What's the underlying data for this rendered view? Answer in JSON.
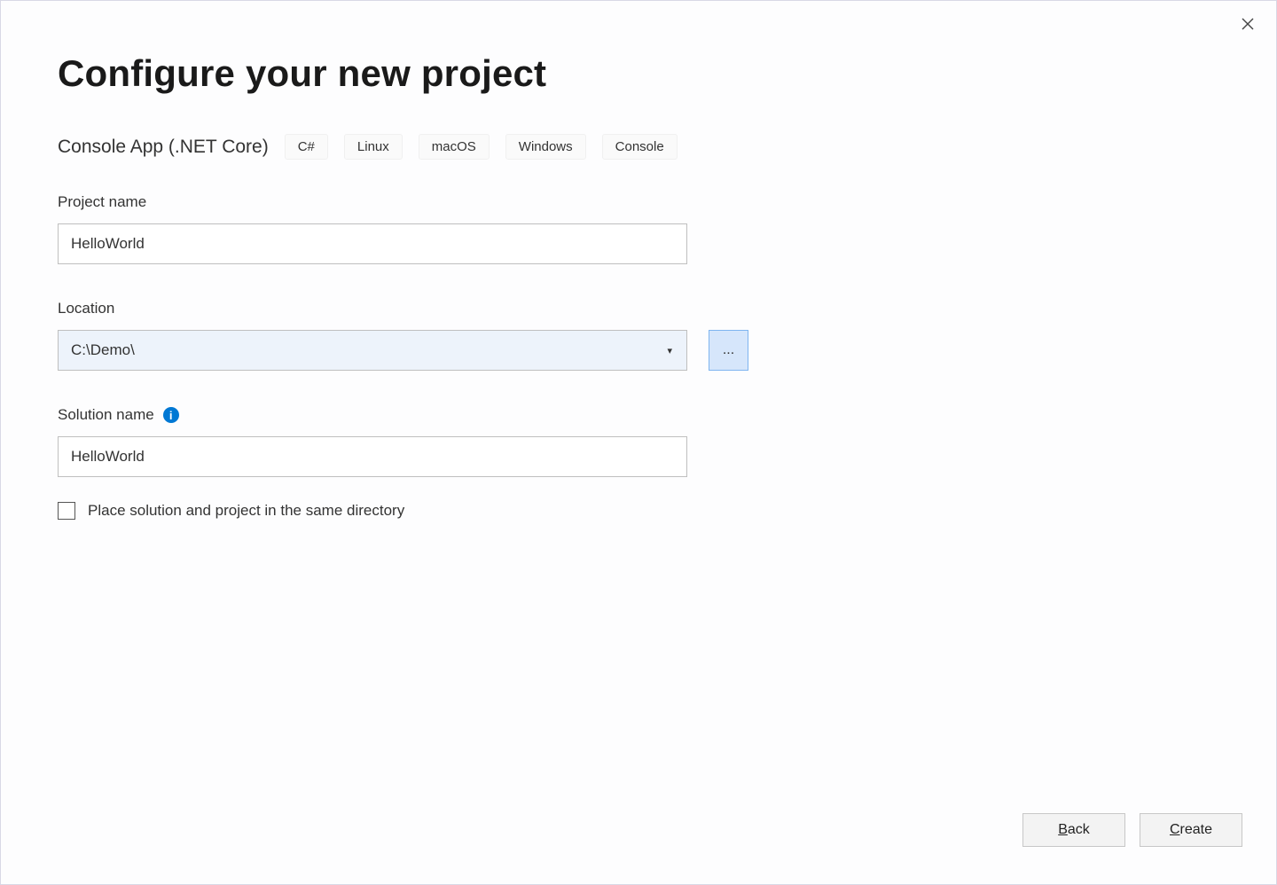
{
  "header": {
    "title": "Configure your new project"
  },
  "template": {
    "name": "Console App (.NET Core)",
    "tags": [
      "C#",
      "Linux",
      "macOS",
      "Windows",
      "Console"
    ]
  },
  "fields": {
    "projectName": {
      "label": "Project name",
      "value": "HelloWorld"
    },
    "location": {
      "label": "Location",
      "value": "C:\\Demo\\",
      "browse": "..."
    },
    "solutionName": {
      "label": "Solution name",
      "value": "HelloWorld"
    },
    "placeSameDir": {
      "label": "Place solution and project in the same directory",
      "checked": false
    }
  },
  "footer": {
    "back": {
      "accel": "B",
      "rest": "ack"
    },
    "create": {
      "accel": "C",
      "rest": "reate"
    }
  }
}
